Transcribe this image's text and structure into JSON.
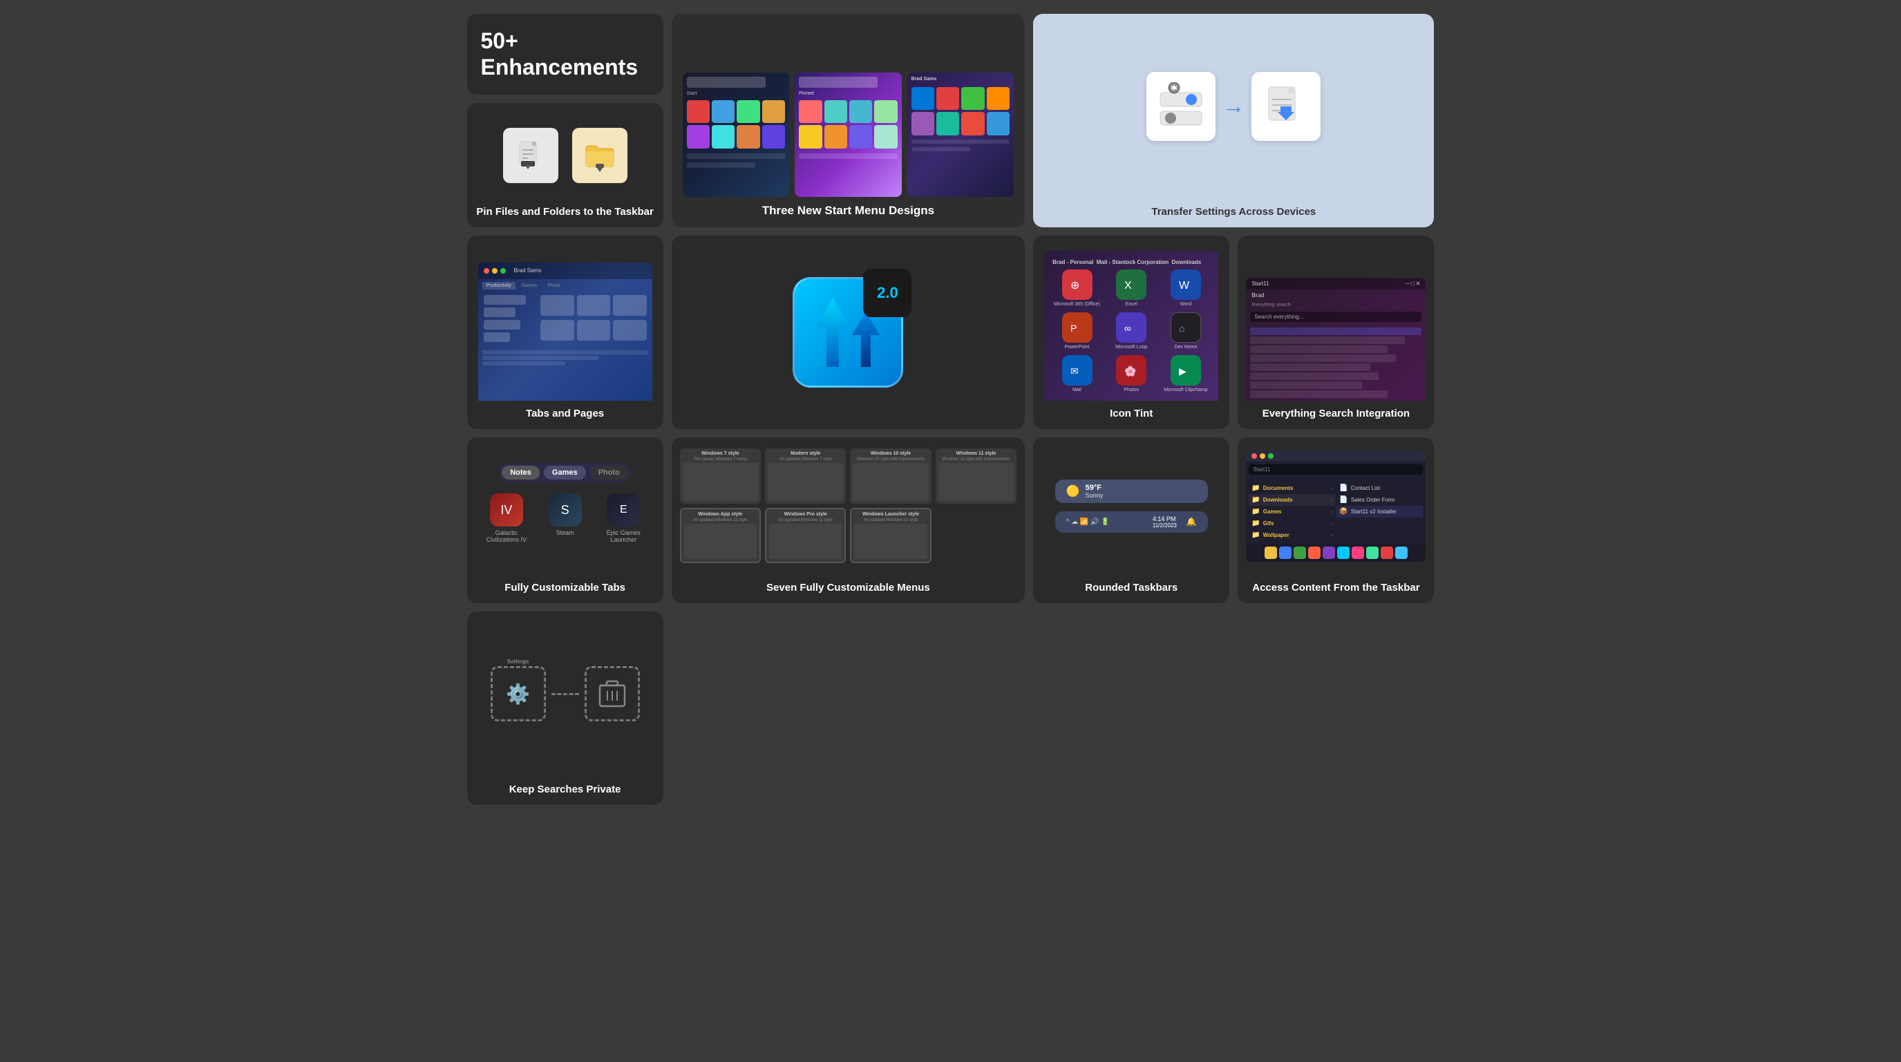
{
  "cards": {
    "enhancements": {
      "title": "50+ Enhancements"
    },
    "pin_files": {
      "label": "Pin Files and Folders to the Taskbar"
    },
    "start_menu": {
      "label": "Three New Start Menu Designs"
    },
    "transfer_settings": {
      "label": "Transfer Settings Across Devices"
    },
    "tabs_pages": {
      "label": "Tabs and Pages"
    },
    "keep_private": {
      "label": "Keep Searches Private"
    },
    "version2": {
      "badge": "2.0"
    },
    "icon_tint": {
      "label": "Icon Tint"
    },
    "everything_search": {
      "label": "Everything Search Integration"
    },
    "custom_tabs": {
      "label": "Fully Customizable Tabs",
      "tabs": [
        "Notes",
        "Games",
        "Photo"
      ]
    },
    "seven_menus": {
      "label": "Seven Fully Customizable Menus",
      "styles": [
        {
          "name": "Windows 7 style",
          "sub": "The classic Windows 7 menu"
        },
        {
          "name": "Modern style",
          "sub": "An updated Windows 7 style"
        },
        {
          "name": "Windows 10 style",
          "sub": "Windows 10 style with improvements"
        },
        {
          "name": "Windows 11 style",
          "sub": "Windows 11 style with improvements"
        },
        {
          "name": "Windows App style",
          "sub": "An updated Windows 11 style"
        },
        {
          "name": "Windows Pro style",
          "sub": "An updated Windows 11 style"
        },
        {
          "name": "Windows Launcher style",
          "sub": "An updated Windows 11 style"
        }
      ]
    },
    "rounded_taskbar": {
      "label": "Rounded Taskbars",
      "weather": "59°F",
      "condition": "Sunny",
      "time": "4:14 PM",
      "date": "11/2/2023"
    },
    "access_content": {
      "label": "Access Content From the Taskbar",
      "folders": [
        "Documents",
        "Downloads",
        "Games",
        "Gifs",
        "Wallpaper"
      ],
      "files": [
        "Contact List",
        "Sales Order Form",
        "Start11 v2 Installer"
      ]
    }
  },
  "colors": {
    "bg": "#3a3a3a",
    "card_bg": "#2a2a2a",
    "accent_blue": "#0078d4",
    "accent_cyan": "#00c8ff"
  }
}
